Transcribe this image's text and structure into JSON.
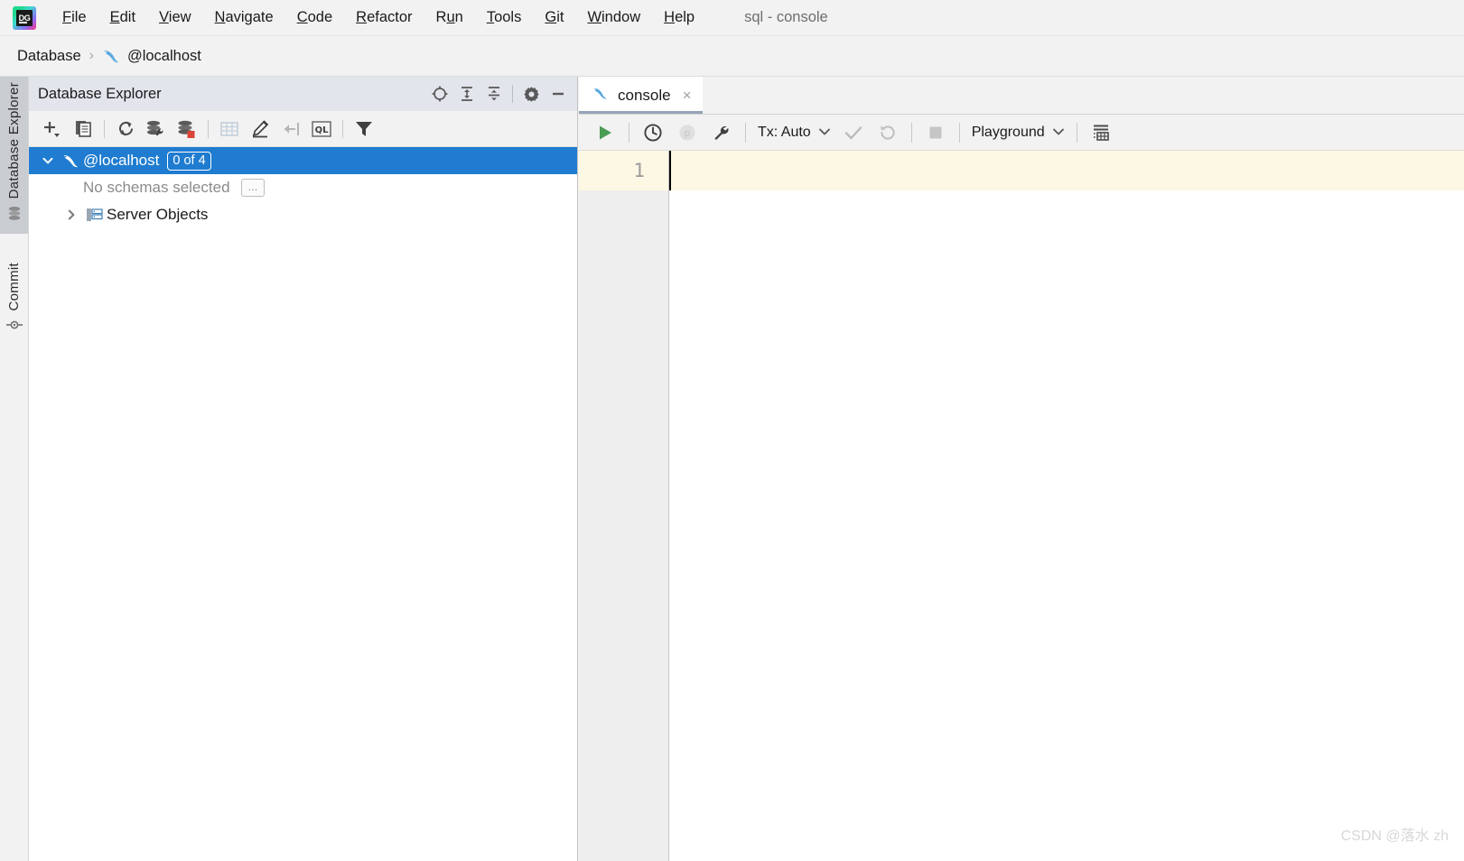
{
  "window": {
    "title": "sql - console",
    "app_logo_text": "DG"
  },
  "menubar": {
    "items": [
      {
        "label": "File",
        "mnemonic": "F"
      },
      {
        "label": "Edit",
        "mnemonic": "E"
      },
      {
        "label": "View",
        "mnemonic": "V"
      },
      {
        "label": "Navigate",
        "mnemonic": "N"
      },
      {
        "label": "Code",
        "mnemonic": "C"
      },
      {
        "label": "Refactor",
        "mnemonic": "R"
      },
      {
        "label": "Run",
        "mnemonic": "u"
      },
      {
        "label": "Tools",
        "mnemonic": "T"
      },
      {
        "label": "Git",
        "mnemonic": "G"
      },
      {
        "label": "Window",
        "mnemonic": "W"
      },
      {
        "label": "Help",
        "mnemonic": "H"
      }
    ]
  },
  "breadcrumb": {
    "root": "Database",
    "separator": "›",
    "current": "@localhost",
    "current_icon": "mysql-dolphin-icon"
  },
  "toolstrip": {
    "buttons": [
      {
        "label": "Database Explorer",
        "icon": "database-icon",
        "active": true
      },
      {
        "label": "Commit",
        "icon": "commit-icon",
        "active": false
      }
    ]
  },
  "explorer": {
    "title": "Database Explorer",
    "header_icons": [
      {
        "name": "locate-target-icon",
        "tooltip": "Select Opened File"
      },
      {
        "name": "expand-all-icon",
        "tooltip": "Expand All"
      },
      {
        "name": "collapse-all-icon",
        "tooltip": "Collapse All"
      },
      {
        "name": "gear-icon",
        "tooltip": "Options"
      },
      {
        "name": "minimize-icon",
        "tooltip": "Hide"
      }
    ],
    "toolbar_icons": [
      {
        "name": "add-data-source-icon",
        "tooltip": "New",
        "enabled": true
      },
      {
        "name": "duplicate-icon",
        "tooltip": "Duplicate",
        "enabled": true
      },
      {
        "name": "refresh-icon",
        "tooltip": "Refresh",
        "enabled": true
      },
      {
        "name": "data-source-properties-icon",
        "tooltip": "Properties",
        "enabled": true
      },
      {
        "name": "disconnect-database-icon",
        "tooltip": "Disconnect",
        "enabled": true
      },
      {
        "name": "open-table-icon",
        "tooltip": "Open Data Editor",
        "enabled": false
      },
      {
        "name": "modify-icon",
        "tooltip": "Modify Object",
        "enabled": true
      },
      {
        "name": "jump-to-editor-icon",
        "tooltip": "Jump to Query Console",
        "enabled": false
      },
      {
        "name": "query-language-icon",
        "tooltip": "QL",
        "enabled": true
      },
      {
        "name": "filter-icon",
        "tooltip": "Filter",
        "enabled": true
      }
    ],
    "tree": {
      "datasource": {
        "label": "@localhost",
        "icon": "mysql-dolphin-icon",
        "badge": "0 of 4",
        "selected": true,
        "expanded": true
      },
      "schemas_row": {
        "label": "No schemas selected",
        "button_label": "..."
      },
      "server_objects": {
        "label": "Server Objects",
        "icon": "server-objects-icon",
        "expanded": false
      }
    }
  },
  "editor": {
    "tabs": [
      {
        "label": "console",
        "icon": "mysql-dolphin-icon",
        "active": true,
        "close_label": "×"
      }
    ],
    "run_toolbar": {
      "icons": [
        {
          "name": "execute-icon",
          "tooltip": "Execute",
          "enabled": true
        },
        {
          "name": "history-clock-icon",
          "tooltip": "History",
          "enabled": true
        },
        {
          "name": "parameters-icon",
          "tooltip": "Parameters",
          "enabled": false
        },
        {
          "name": "session-settings-wrench-icon",
          "tooltip": "Session Settings",
          "enabled": true
        },
        {
          "name": "commit-check-icon",
          "tooltip": "Commit",
          "enabled": false
        },
        {
          "name": "rollback-icon",
          "tooltip": "Rollback",
          "enabled": false
        },
        {
          "name": "stop-icon",
          "tooltip": "Stop",
          "enabled": false
        },
        {
          "name": "output-panel-icon",
          "tooltip": "Show Output",
          "enabled": true
        }
      ],
      "tx_mode": {
        "label": "Tx: Auto",
        "caret": "⌄"
      },
      "schema_selector": {
        "label": "Playground",
        "caret": "⌄"
      }
    },
    "gutter": {
      "line_numbers": [
        "1"
      ]
    },
    "content": ""
  },
  "watermark": "CSDN @落水 zh",
  "colors": {
    "accent_selection": "#1f7cd0",
    "panel_header": "#e2e5ec",
    "toolbar_bg": "#f2f2f2",
    "current_line": "#fdf8e3",
    "run_green": "#499c54",
    "disconnect_red": "#db4437",
    "tab_underline": "#93a3b8"
  }
}
